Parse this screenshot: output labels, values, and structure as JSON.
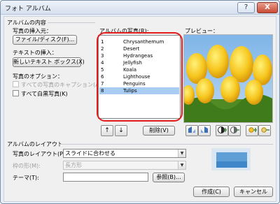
{
  "window": {
    "title": "フォト アルバム",
    "help_label": "?",
    "close_label": "X"
  },
  "album_content": {
    "group_label": "アルバムの内容",
    "insert_picture_label": "写真の挿入元：",
    "file_disk_button": "ファイル/ディスク(F)...",
    "insert_text_label": "テキストの挿入：",
    "new_textbox_button": "新しいテキスト ボックス(X)",
    "options_label": "写真のオプション：",
    "captions_option": "すべての写真のキャプション(A)",
    "bw_option": "すべて白黒写真(K)",
    "captions_checked": false,
    "bw_checked": false
  },
  "album_pictures": {
    "label": "アルバムの写真(R):",
    "items": [
      {
        "num": "1",
        "name": "Chrysanthemum",
        "selected": false
      },
      {
        "num": "2",
        "name": "Desert",
        "selected": false
      },
      {
        "num": "3",
        "name": "Hydrangeas",
        "selected": false
      },
      {
        "num": "4",
        "name": "Jellyfish",
        "selected": false
      },
      {
        "num": "5",
        "name": "Koala",
        "selected": false
      },
      {
        "num": "6",
        "name": "Lighthouse",
        "selected": false
      },
      {
        "num": "7",
        "name": "Penguins",
        "selected": false
      },
      {
        "num": "8",
        "name": "Tulips",
        "selected": true
      }
    ],
    "move_up_symbol": "↑",
    "move_down_symbol": "↓",
    "delete_button": "削除(V)"
  },
  "preview": {
    "label": "プレビュー："
  },
  "image_tools": {
    "rotate_left_icon": "rotate-left-icon",
    "rotate_right_icon": "rotate-right-icon",
    "contrast_up_icon": "contrast-up-icon",
    "contrast_down_icon": "contrast-down-icon",
    "brightness_up_icon": "brightness-up-icon",
    "brightness_down_icon": "brightness-down-icon"
  },
  "album_layout": {
    "group_label": "アルバムのレイアウト",
    "picture_layout_label": "写真のレイアウト(P):",
    "picture_layout_value": "スライドに合わせる",
    "frame_shape_label": "枠の形(M):",
    "frame_shape_value": "長方形",
    "theme_label": "テーマ(T):",
    "theme_value": "",
    "browse_button": "参照(B)..."
  },
  "actions": {
    "create_button": "作成(C)",
    "cancel_button": "キャンセル"
  },
  "colors": {
    "selection": "#a9ccf2",
    "highlight_ring": "#e31b1b",
    "close_button": "#c94a33"
  }
}
